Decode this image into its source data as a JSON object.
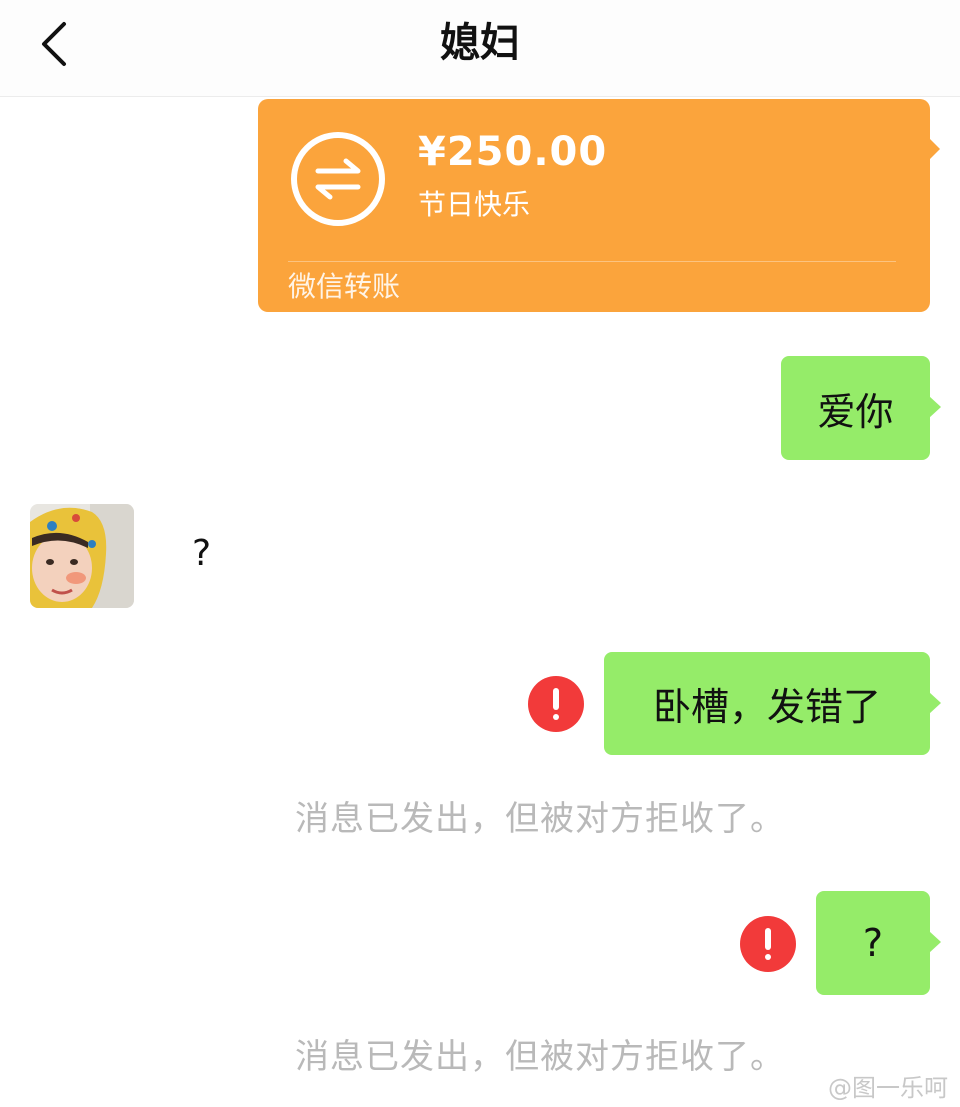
{
  "header": {
    "back_icon": "chevron-left-icon",
    "title": "媳妇"
  },
  "transfer": {
    "amount": "¥250.00",
    "note": "节日快乐",
    "footer": "微信转账",
    "icon": "transfer-arrows-icon",
    "color": "#fba43c"
  },
  "messages": {
    "outgoing_1": "爱你",
    "incoming_1": "?",
    "outgoing_2": "卧槽，发错了",
    "outgoing_2_status": "error",
    "system_1": "消息已发出，但被对方拒收了。",
    "outgoing_3": "?",
    "outgoing_3_status": "error",
    "system_2": "消息已发出，但被对方拒收了。"
  },
  "colors": {
    "bubble_green": "#95ec69",
    "error_red": "#f23a3a",
    "system_text": "#b9b9b9"
  },
  "watermark": "@图一乐呵"
}
